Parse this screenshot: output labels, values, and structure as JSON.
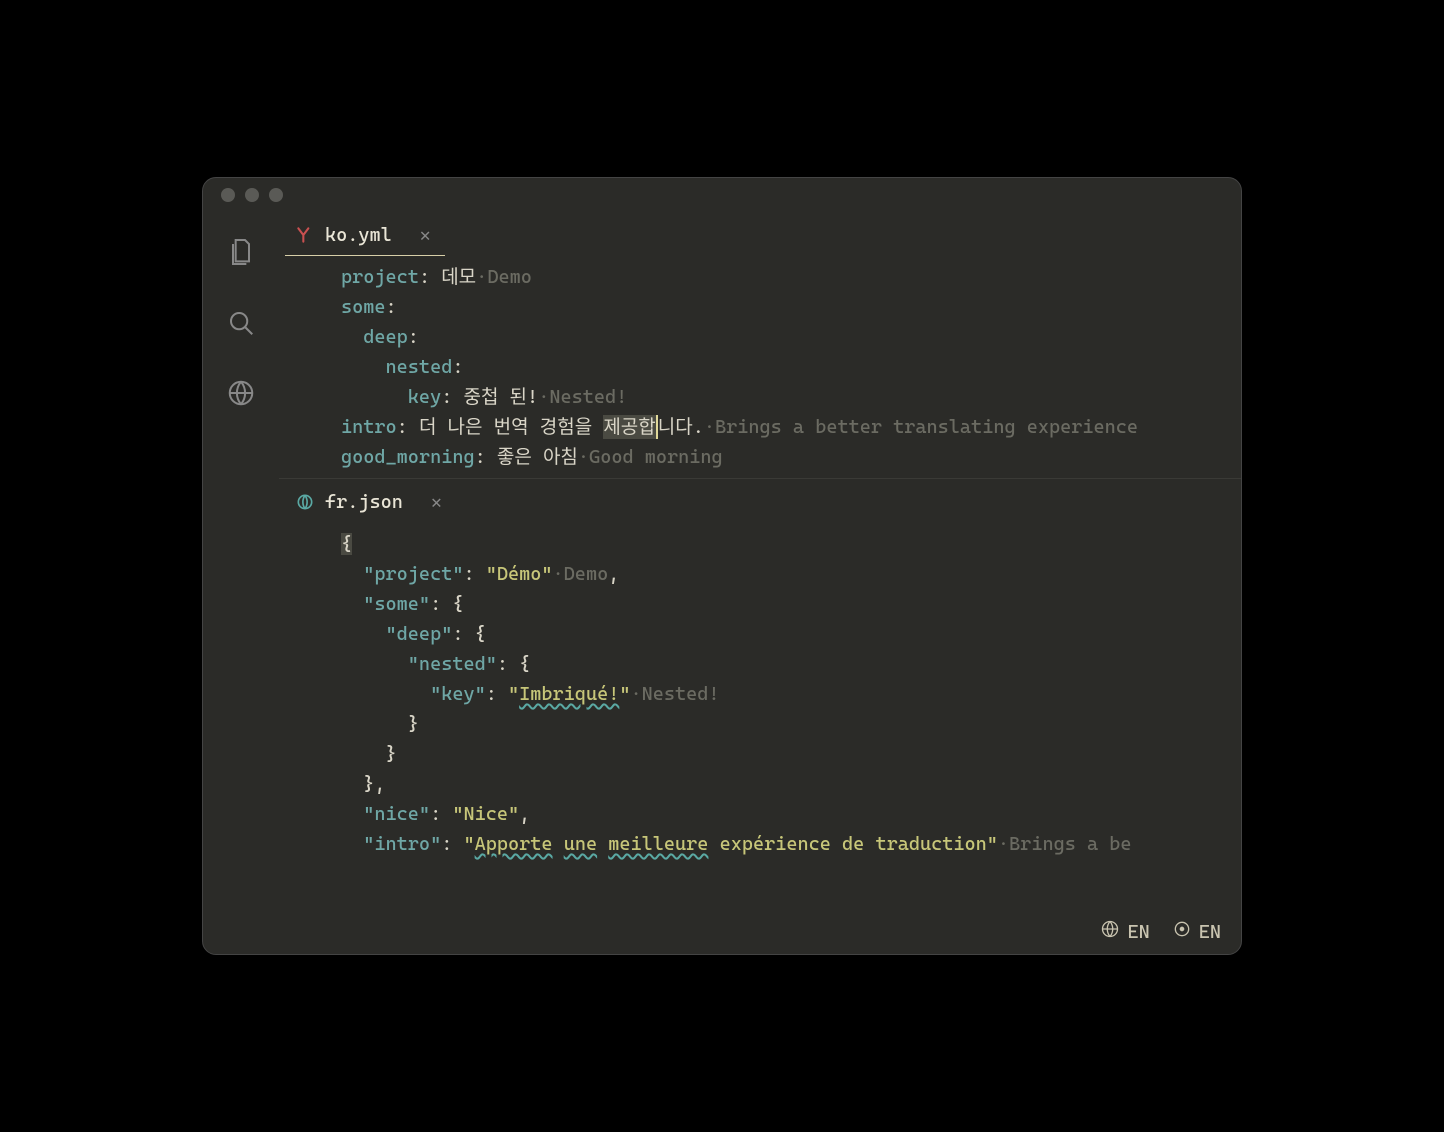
{
  "tabs": {
    "top": {
      "filename": "ko.yml"
    },
    "bottom": {
      "filename": "fr.json"
    }
  },
  "yaml": {
    "project_key": "project",
    "project_val": "데모",
    "project_hint": "Demo",
    "some_key": "some",
    "deep_key": "deep",
    "nested_key": "nested",
    "key_key": "key",
    "key_val": "중첩 된!",
    "key_hint": "Nested!",
    "intro_key": "intro",
    "intro_val_pre": "더 나은 번역 경험을 ",
    "intro_val_cursor": "제공합",
    "intro_val_post": "니다.",
    "intro_hint": "Brings a better translating experience",
    "gm_key": "good_morning",
    "gm_val": "좋은 아침",
    "gm_hint": "Good morning"
  },
  "json": {
    "project_key": "\"project\"",
    "project_val": "\"Démo\"",
    "project_hint": "Demo",
    "some_key": "\"some\"",
    "deep_key": "\"deep\"",
    "nested_key": "\"nested\"",
    "key_key": "\"key\"",
    "key_val_open": "\"",
    "key_val_text": "Imbriqué!",
    "key_val_close": "\"",
    "key_hint": "Nested!",
    "nice_key": "\"nice\"",
    "nice_val": "\"Nice\"",
    "intro_key": "\"intro\"",
    "intro_val_open": "\"",
    "intro_val_w1": "Apporte",
    "intro_val_sp1": " ",
    "intro_val_w2": "une",
    "intro_val_sp2": " ",
    "intro_val_w3": "meilleure",
    "intro_val_sp3": " ",
    "intro_val_rest": "expérience de traduction\"",
    "intro_hint": "Brings a be"
  },
  "status": {
    "lang1": "EN",
    "lang2": "EN"
  }
}
